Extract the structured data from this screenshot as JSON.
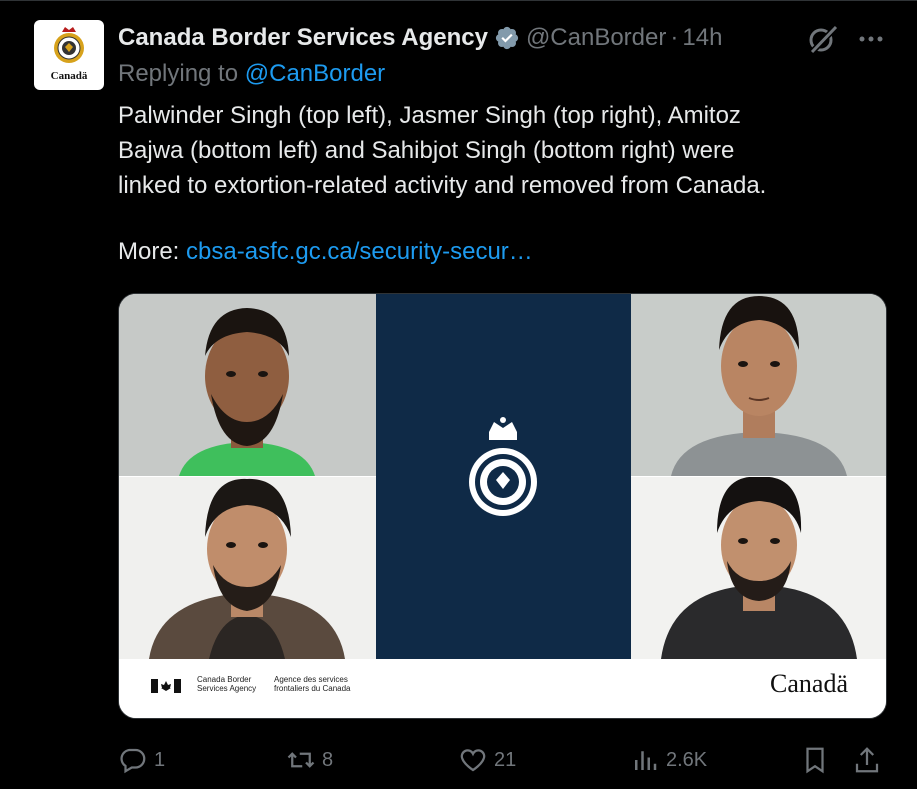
{
  "author": {
    "name": "Canada Border Services Agency",
    "handle": "@CanBorder",
    "separator": "·",
    "time": "14h",
    "avatar_wordmark": "Canadä"
  },
  "reply": {
    "prefix": "Replying to",
    "mention": "@CanBorder"
  },
  "tweet": {
    "lines": [
      "Palwinder Singh (top left), Jasmer Singh (top right), Amitoz",
      "Bajwa (bottom left) and Sahibjot Singh (bottom right) were",
      "linked to extortion-related activity and removed from Canada."
    ],
    "more_label": "More:",
    "link_text": "cbsa-asfc.gc.ca/security-secur…"
  },
  "media": {
    "agency_en_line1": "Canada Border",
    "agency_en_line2": "Services Agency",
    "agency_fr_line1": "Agence des services",
    "agency_fr_line2": "frontaliers du Canada",
    "wordmark": "Canadä"
  },
  "actions": {
    "replies": "1",
    "reposts": "8",
    "likes": "21",
    "views": "2.6K"
  },
  "colors": {
    "background": "#000000",
    "text": "#e7e9ea",
    "muted": "#71767b",
    "accent": "#1d9bf0",
    "navy": "#0f2a47"
  }
}
